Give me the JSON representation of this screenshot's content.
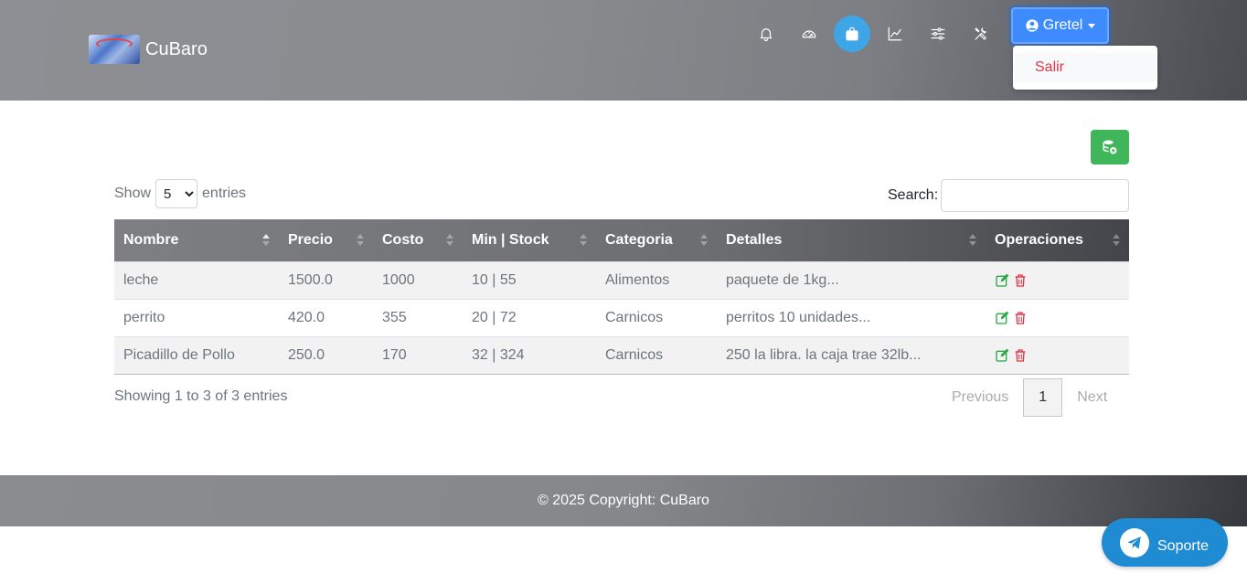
{
  "header": {
    "brand_name": "CuBaro",
    "nav_icons": [
      "bell-icon",
      "speedometer-icon",
      "bag-icon",
      "chart-line-icon",
      "sliders-icon",
      "tools-icon"
    ],
    "active_nav": "bag-icon",
    "user_label": "Gretel",
    "dropdown_items": [
      "Salir"
    ]
  },
  "controls": {
    "show_label": "Show",
    "entries_value": "5",
    "entries_label": "entries",
    "search_label": "Search:",
    "search_value": ""
  },
  "table": {
    "columns": [
      "Nombre",
      "Precio",
      "Costo",
      "Min | Stock",
      "Categoria",
      "Detalles",
      "Operaciones"
    ],
    "sorted_column": "Nombre",
    "rows": [
      {
        "nombre": "leche",
        "precio": "1500.0",
        "costo": "1000",
        "min_stock": "10 | 55",
        "categoria": "Alimentos",
        "detalles": "paquete de 1kg..."
      },
      {
        "nombre": "perrito",
        "precio": "420.0",
        "costo": "355",
        "min_stock": "20 | 72",
        "categoria": "Carnicos",
        "detalles": "perritos 10 unidades..."
      },
      {
        "nombre": "Picadillo de Pollo",
        "precio": "250.0",
        "costo": "170",
        "min_stock": "32 | 324",
        "categoria": "Carnicos",
        "detalles": "250 la libra. la caja trae 32lb..."
      }
    ]
  },
  "pagination": {
    "info": "Showing 1 to 3 of 3 entries",
    "previous": "Previous",
    "current_page": "1",
    "next": "Next"
  },
  "footer": {
    "copyright": "© 2025 Copyright: CuBaro"
  },
  "support": {
    "label": "Soporte"
  },
  "colors": {
    "accent_blue": "#3d8bfd",
    "active_nav": "#3ea6e6",
    "add_button": "#3fb65a",
    "edit_icon": "#28a745",
    "delete_icon": "#dc3545",
    "support_button": "#1f8bd3"
  }
}
